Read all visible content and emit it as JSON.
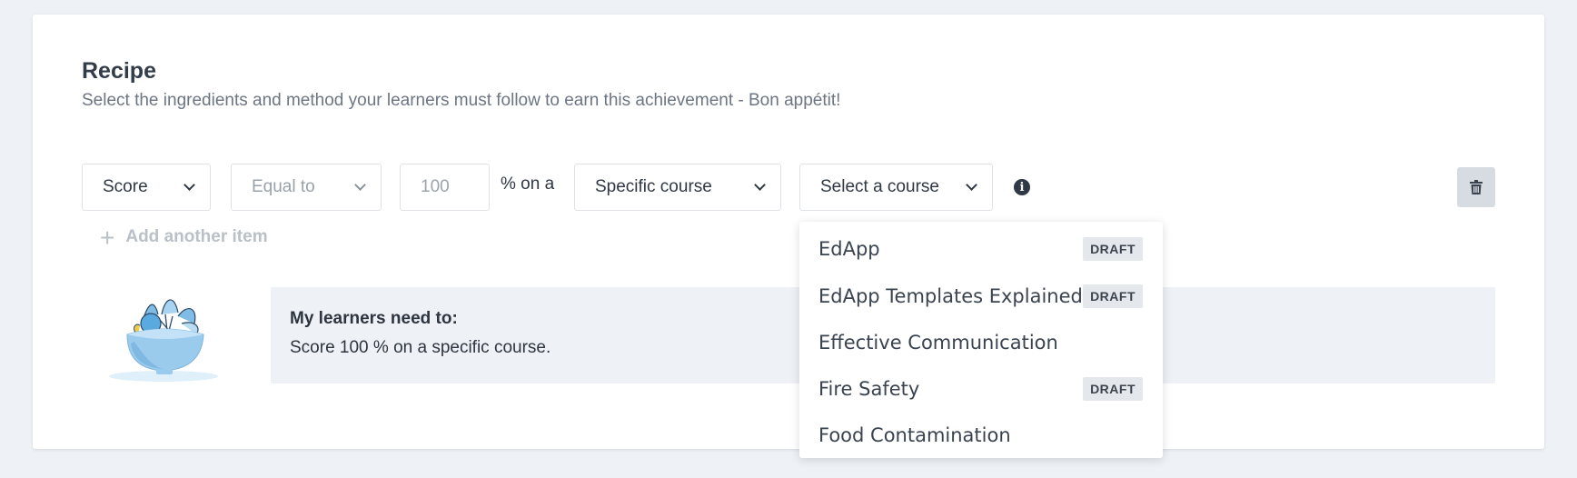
{
  "recipe": {
    "title": "Recipe",
    "subtitle": "Select the ingredients and method your learners must follow to earn this achievement - Bon appétit!"
  },
  "rule": {
    "metric": "Score",
    "comparison": "Equal to",
    "value_placeholder": "100",
    "connector": "% on a",
    "scope": "Specific course",
    "course": "Select a course"
  },
  "add_item_label": "Add another item",
  "summary": {
    "title": "My learners need to:",
    "text": "Score 100 % on a specific course."
  },
  "course_options": [
    {
      "label": "EdApp",
      "badge": "DRAFT"
    },
    {
      "label": "EdApp Templates Explained",
      "badge": "DRAFT"
    },
    {
      "label": "Effective Communication",
      "badge": ""
    },
    {
      "label": "Fire Safety",
      "badge": "DRAFT"
    },
    {
      "label": "Food Contamination",
      "badge": ""
    }
  ],
  "icons": {
    "info": "info-icon",
    "delete": "trash-icon",
    "add": "plus-icon",
    "illustration": "salad-bowl-illustration"
  },
  "colors": {
    "background": "#eef1f5",
    "card": "#ffffff",
    "text": "#2d3540",
    "muted_text": "#99a1ab",
    "badge_bg": "#e4e7eb",
    "bowl": "#8fc3ea"
  }
}
